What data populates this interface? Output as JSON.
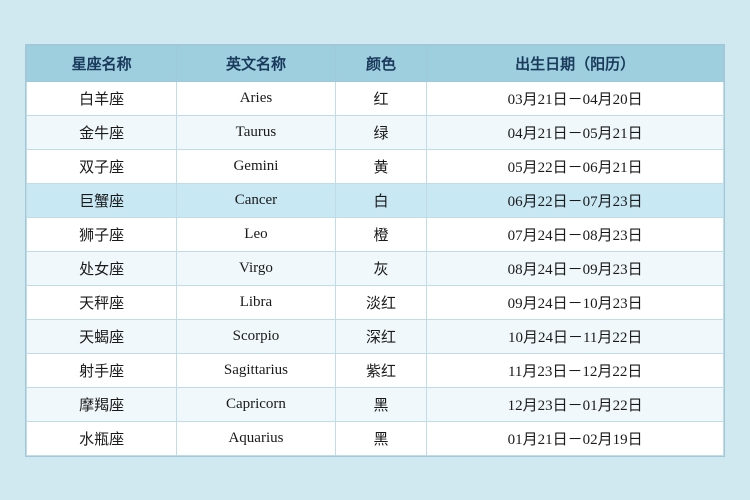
{
  "table": {
    "headers": [
      "星座名称",
      "英文名称",
      "颜色",
      "出生日期（阳历）"
    ],
    "rows": [
      {
        "chinese": "白羊座",
        "english": "Aries",
        "color": "红",
        "dates": "03月21日－04月20日"
      },
      {
        "chinese": "金牛座",
        "english": "Taurus",
        "color": "绿",
        "dates": "04月21日－05月21日"
      },
      {
        "chinese": "双子座",
        "english": "Gemini",
        "color": "黄",
        "dates": "05月22日－06月21日"
      },
      {
        "chinese": "巨蟹座",
        "english": "Cancer",
        "color": "白",
        "dates": "06月22日－07月23日",
        "highlight": true
      },
      {
        "chinese": "狮子座",
        "english": "Leo",
        "color": "橙",
        "dates": "07月24日－08月23日"
      },
      {
        "chinese": "处女座",
        "english": "Virgo",
        "color": "灰",
        "dates": "08月24日－09月23日"
      },
      {
        "chinese": "天秤座",
        "english": "Libra",
        "color": "淡红",
        "dates": "09月24日－10月23日"
      },
      {
        "chinese": "天蝎座",
        "english": "Scorpio",
        "color": "深红",
        "dates": "10月24日－11月22日"
      },
      {
        "chinese": "射手座",
        "english": "Sagittarius",
        "color": "紫红",
        "dates": "11月23日－12月22日"
      },
      {
        "chinese": "摩羯座",
        "english": "Capricorn",
        "color": "黑",
        "dates": "12月23日－01月22日"
      },
      {
        "chinese": "水瓶座",
        "english": "Aquarius",
        "color": "黑",
        "dates": "01月21日－02月19日"
      }
    ]
  }
}
